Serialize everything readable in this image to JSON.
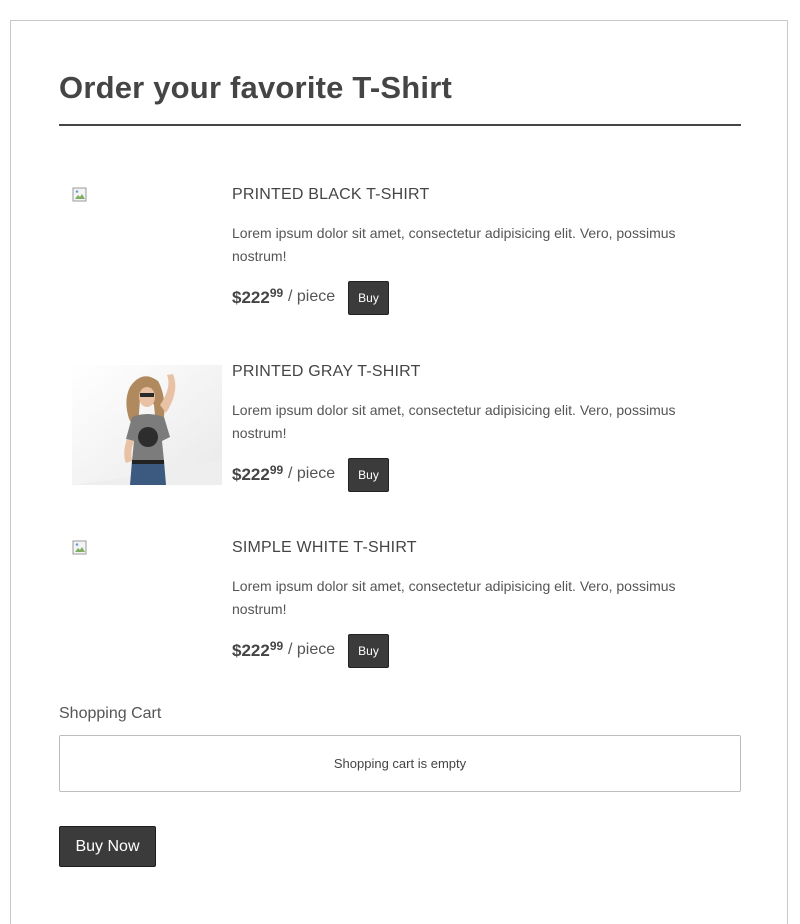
{
  "page": {
    "title": "Order your favorite T-Shirt"
  },
  "products": [
    {
      "name": "PRINTED BLACK T-SHIRT",
      "description": "Lorem ipsum dolor sit amet, consectetur adipisicing elit. Vero, possimus nostrum!",
      "price_main": "$222",
      "price_cents": "99",
      "unit": "/ piece",
      "buy_label": "Buy",
      "image": "broken-image-icon"
    },
    {
      "name": "PRINTED GRAY T-SHIRT",
      "description": "Lorem ipsum dolor sit amet, consectetur adipisicing elit. Vero, possimus nostrum!",
      "price_main": "$222",
      "price_cents": "99",
      "unit": "/ piece",
      "buy_label": "Buy",
      "image": "product-photo"
    },
    {
      "name": "SIMPLE WHITE T-SHIRT",
      "description": "Lorem ipsum dolor sit amet, consectetur adipisicing elit. Vero, possimus nostrum!",
      "price_main": "$222",
      "price_cents": "99",
      "unit": "/ piece",
      "buy_label": "Buy",
      "image": "broken-image-icon"
    }
  ],
  "cart": {
    "label": "Shopping Cart",
    "empty_text": "Shopping cart is empty",
    "buy_now_label": "Buy Now"
  },
  "colors": {
    "text": "#454545",
    "button_bg": "#3b3b3b",
    "border": "#c9c9c9"
  }
}
